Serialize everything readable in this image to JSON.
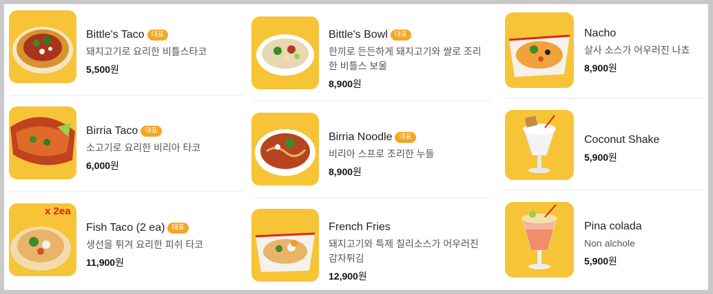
{
  "badge_label": "대표",
  "currency_suffix": "원",
  "colors": {
    "thumb_bg": "#f7c437",
    "badge_bg": "#f5a623"
  },
  "columns": [
    {
      "items": [
        {
          "name": "Bittle's Taco",
          "badge": true,
          "desc": "돼지고기로 요리한 비틀스타코",
          "price": "5,500",
          "image": "taco-plate-image"
        },
        {
          "name": "Birria Taco",
          "badge": true,
          "desc": "소고기로 요리한 비리아 타코",
          "price": "6,000",
          "image": "birria-taco-image"
        },
        {
          "name": "Fish Taco (2 ea)",
          "badge": true,
          "desc": "생선을 튀겨 요리한 피쉬 타코",
          "price": "11,900",
          "image": "fish-taco-image",
          "image_text": "x 2ea"
        }
      ]
    },
    {
      "items": [
        {
          "name": "Bittle's Bowl",
          "badge": true,
          "desc": "한끼로 든든하게 돼지고기와 쌀로 조리한 비틀스 보울",
          "price": "8,900",
          "image": "rice-bowl-image"
        },
        {
          "name": "Birria Noodle",
          "badge": true,
          "desc": "비리아 스프로 조리한 누들",
          "price": "8,900",
          "image": "noodle-bowl-image"
        },
        {
          "name": "French Fries",
          "badge": false,
          "desc": "돼지고기와 특제 칠리소스가 어우러진 감자튀김",
          "price": "12,900",
          "image": "fries-basket-image"
        }
      ]
    },
    {
      "items": [
        {
          "name": "Nacho",
          "badge": false,
          "desc": "살사 소스가 어우러진 나쵸",
          "price": "8,900",
          "image": "nacho-basket-image"
        },
        {
          "name": "Coconut Shake",
          "badge": false,
          "desc": "",
          "price": "5,900",
          "image": "coconut-shake-image"
        },
        {
          "name": "Pina colada",
          "badge": false,
          "desc": "Non alchole",
          "price": "5,900",
          "image": "pina-colada-image"
        }
      ]
    }
  ]
}
